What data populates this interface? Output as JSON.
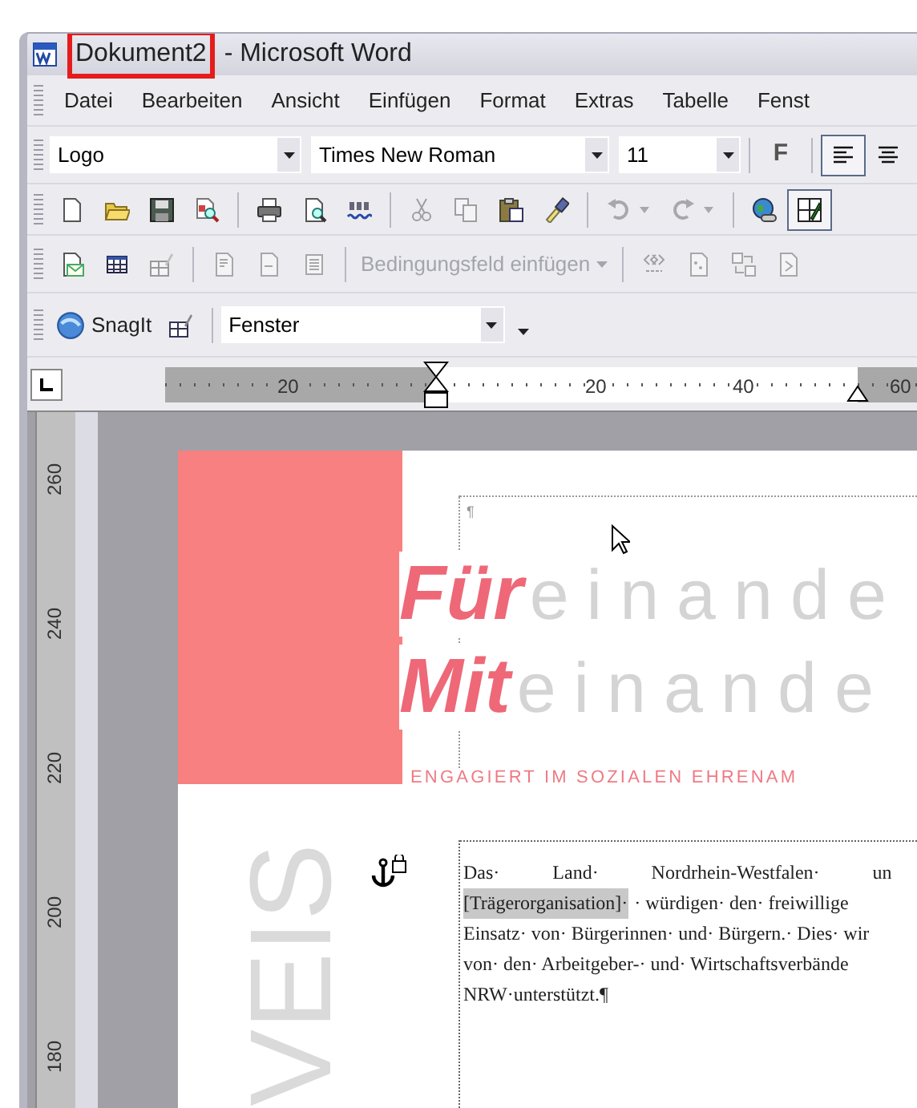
{
  "window": {
    "document_name": "Dokument2",
    "document_name_highlighted": true,
    "app_name": "- Microsoft Word"
  },
  "menu": [
    {
      "label": "Datei"
    },
    {
      "label": "Bearbeiten"
    },
    {
      "label": "Ansicht"
    },
    {
      "label": "Einfügen"
    },
    {
      "label": "Format"
    },
    {
      "label": "Extras"
    },
    {
      "label": "Tabelle"
    },
    {
      "label": "Fenst"
    }
  ],
  "formatting_toolbar": {
    "style": "Logo",
    "font": "Times New Roman",
    "size": "11",
    "bold_label": "F",
    "align": [
      {
        "kind": "left",
        "selected": true
      },
      {
        "kind": "center",
        "selected": false
      }
    ]
  },
  "standard_toolbar": [
    {
      "kind": "new",
      "disabled": false,
      "pressed": false
    },
    {
      "kind": "open",
      "disabled": false,
      "pressed": false
    },
    {
      "kind": "save",
      "disabled": false,
      "pressed": false
    },
    {
      "kind": "permission",
      "disabled": false,
      "pressed": false
    },
    {
      "kind": "separator"
    },
    {
      "kind": "print",
      "disabled": false,
      "pressed": false
    },
    {
      "kind": "preview",
      "disabled": false,
      "pressed": false
    },
    {
      "kind": "spelling",
      "disabled": false,
      "pressed": false
    },
    {
      "kind": "separator"
    },
    {
      "kind": "cut",
      "disabled": true,
      "pressed": false
    },
    {
      "kind": "copy",
      "disabled": true,
      "pressed": false
    },
    {
      "kind": "paste",
      "disabled": false,
      "pressed": false
    },
    {
      "kind": "painter",
      "disabled": false,
      "pressed": false
    },
    {
      "kind": "separator"
    },
    {
      "kind": "undo",
      "disabled": true,
      "pressed": false
    },
    {
      "kind": "redo",
      "disabled": true,
      "pressed": false
    },
    {
      "kind": "separator"
    },
    {
      "kind": "hyperlink",
      "disabled": false,
      "pressed": false
    },
    {
      "kind": "tables",
      "disabled": false,
      "pressed": true
    }
  ],
  "mail_merge_toolbar": [
    {
      "kind": "maindoc",
      "disabled": false
    },
    {
      "kind": "datatable",
      "disabled": false
    },
    {
      "kind": "recipients",
      "disabled": true
    },
    {
      "kind": "separator"
    },
    {
      "kind": "address",
      "disabled": true
    },
    {
      "kind": "greeting",
      "disabled": true
    },
    {
      "kind": "lines",
      "disabled": true
    },
    {
      "kind": "separator"
    },
    {
      "kind": "menu",
      "label": "Bedingungsfeld einfügen",
      "disabled": true
    },
    {
      "kind": "separator"
    },
    {
      "kind": "mergefield",
      "disabled": true
    },
    {
      "kind": "dots",
      "disabled": true
    },
    {
      "kind": "swap",
      "disabled": true
    },
    {
      "kind": "recheck",
      "disabled": true
    }
  ],
  "snagit_toolbar": {
    "button_label": "SnagIt",
    "field": "Fenster"
  },
  "ruler": {
    "labels": [
      "20",
      "20",
      "40",
      "60"
    ]
  },
  "vertical_ruler": {
    "labels": [
      "260",
      "240",
      "220",
      "200",
      "180"
    ]
  },
  "document": {
    "box_mark": "¶",
    "logo": [
      {
        "lead": "Für",
        "rest": "einande"
      },
      {
        "lead": "Mit",
        "rest": "einande"
      }
    ],
    "tagline": "ENGAGIERT IM SOZIALEN EHRENAM",
    "side_text": "VEIS",
    "paragraph": [
      [
        {
          "kind": "text",
          "text": "Das· Land· Nordrhein-Westfalen· un",
          "justified": true
        }
      ],
      [
        {
          "kind": "field",
          "text": "[Trägerorganisation]·"
        },
        {
          "kind": "text",
          "text": "· würdigen· den· freiwillige"
        }
      ],
      [
        {
          "kind": "text",
          "text": "Einsatz· von· Bürgerinnen· und· Bürgern.· Dies· wir"
        }
      ],
      [
        {
          "kind": "text",
          "text": "von· den· Arbeitgeber-· und· Wirtschaftsverbände"
        }
      ],
      [
        {
          "kind": "text",
          "text": "NRW·unterstützt.¶"
        }
      ]
    ]
  }
}
